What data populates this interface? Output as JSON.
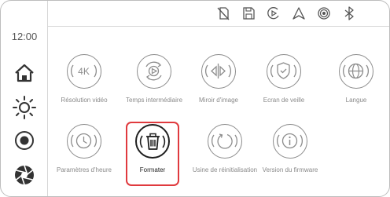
{
  "sidebar": {
    "time": "12:00",
    "buttons": [
      {
        "icon": "home-icon"
      },
      {
        "icon": "brightness-icon"
      },
      {
        "icon": "record-icon"
      },
      {
        "icon": "aperture-icon"
      }
    ]
  },
  "statusbar": {
    "icons": [
      "sd-card-off-icon",
      "memory-card-icon",
      "loop-record-icon",
      "gps-icon",
      "wifi-icon",
      "bluetooth-icon"
    ]
  },
  "settings": {
    "selected": "Formater",
    "accent_color": "#e03a3e",
    "tiles": [
      {
        "label": "Résolution vidéo",
        "icon": "4k-icon",
        "badge": "4K"
      },
      {
        "label": "Temps intermédiaire",
        "icon": "loop-play-icon"
      },
      {
        "label": "Miroir d'image",
        "icon": "mirror-icon"
      },
      {
        "label": "Ecran de veille",
        "icon": "screensaver-shield-icon"
      },
      {
        "label": "Langue",
        "icon": "globe-icon"
      },
      {
        "label": "Paramètres d'heure",
        "icon": "clock-icon"
      },
      {
        "label": "Formater",
        "icon": "trash-icon"
      },
      {
        "label": "Usine de réinitialisation",
        "icon": "factory-reset-icon"
      },
      {
        "label": "Version du firmware",
        "icon": "info-icon"
      }
    ]
  }
}
